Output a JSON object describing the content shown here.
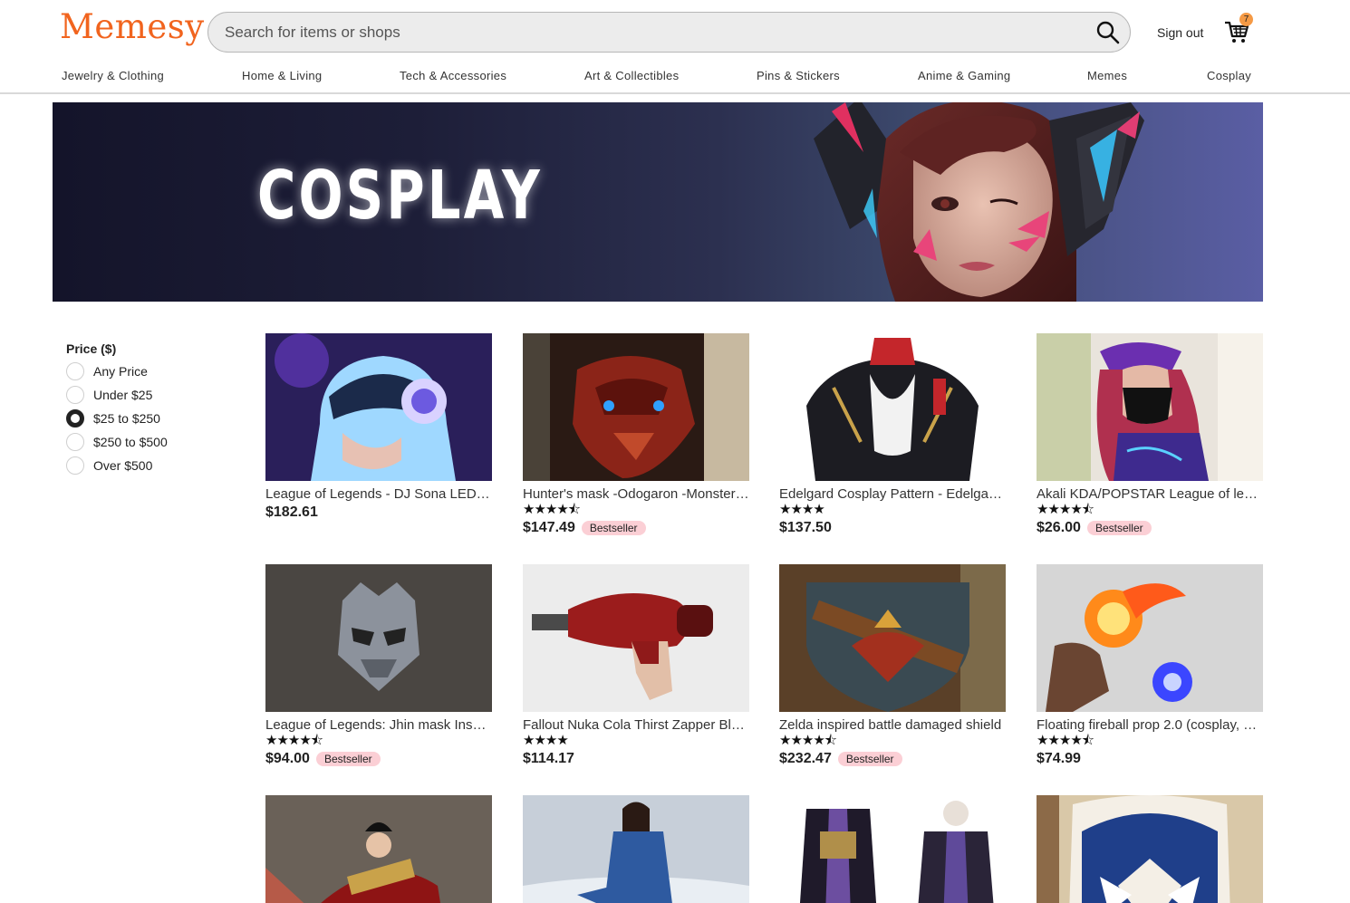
{
  "header": {
    "logo": "Memesy",
    "search_placeholder": "Search for items or shops",
    "sign_out": "Sign out",
    "cart_count": "7"
  },
  "nav": [
    {
      "label": "Jewelry & Clothing"
    },
    {
      "label": "Home & Living"
    },
    {
      "label": "Tech & Accessories"
    },
    {
      "label": "Art & Collectibles"
    },
    {
      "label": "Pins & Stickers"
    },
    {
      "label": "Anime & Gaming"
    },
    {
      "label": "Memes"
    },
    {
      "label": "Cosplay"
    }
  ],
  "banner": {
    "title": "COSPLAY"
  },
  "filter": {
    "title": "Price ($)",
    "options": [
      {
        "label": "Any Price",
        "checked": false
      },
      {
        "label": "Under $25",
        "checked": false
      },
      {
        "label": "$25 to $250",
        "checked": true
      },
      {
        "label": "$250 to $500",
        "checked": false
      },
      {
        "label": "Over $500",
        "checked": false
      }
    ]
  },
  "products": [
    {
      "name": "League of Legends - DJ Sona LED Helmet",
      "stars": "",
      "price": "$182.61",
      "badge": ""
    },
    {
      "name": "Hunter's mask -Odogaron -Monster Hunter",
      "stars": "★★★★⯪",
      "price": "$147.49",
      "badge": "Bestseller"
    },
    {
      "name": "Edelgard Cosplay Pattern - Edelgard von Hresvelg",
      "stars": "★★★★",
      "price": "$137.50",
      "badge": ""
    },
    {
      "name": "Akali KDA/POPSTAR League of legends",
      "stars": "★★★★⯪",
      "price": "$26.00",
      "badge": "Bestseller"
    },
    {
      "name": "League of Legends: Jhin mask Inspired",
      "stars": "★★★★⯪",
      "price": "$94.00",
      "badge": "Bestseller"
    },
    {
      "name": "Fallout Nuka Cola Thirst Zapper Blaster",
      "stars": "★★★★",
      "price": "$114.17",
      "badge": ""
    },
    {
      "name": "Zelda inspired battle damaged shield",
      "stars": "★★★★⯪",
      "price": "$232.47",
      "badge": "Bestseller"
    },
    {
      "name": "Floating fireball prop 2.0 (cosplay, LARP)",
      "stars": "★★★★⯪",
      "price": "$74.99",
      "badge": ""
    },
    {
      "name": "",
      "stars": "",
      "price": "",
      "badge": ""
    },
    {
      "name": "",
      "stars": "",
      "price": "",
      "badge": ""
    },
    {
      "name": "",
      "stars": "",
      "price": "",
      "badge": ""
    },
    {
      "name": "",
      "stars": "",
      "price": "",
      "badge": ""
    }
  ],
  "colors": {
    "brand": "#f1641e",
    "badge": "#fbcfd5",
    "cart_badge": "#f59a45"
  }
}
